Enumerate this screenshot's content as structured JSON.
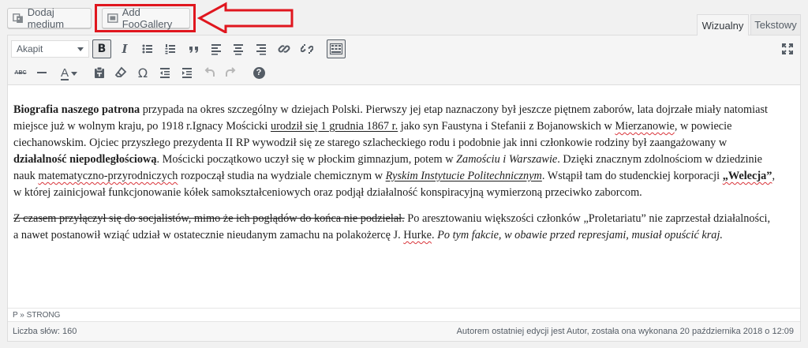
{
  "toolbar_top": {
    "add_media_label": "Dodaj medium",
    "add_foogallery_label": "Add FooGallery",
    "tab_visual": "Wizualny",
    "tab_text": "Tekstowy"
  },
  "editor_toolbar": {
    "format_select_value": "Akapit",
    "row1_icons": [
      "bold-icon",
      "italic-icon",
      "bulleted-list-icon",
      "numbered-list-icon",
      "blockquote-icon",
      "align-left-icon",
      "align-center-icon",
      "align-right-icon",
      "link-icon",
      "unlink-icon",
      "toolbar-toggle-icon",
      "fullscreen-icon"
    ],
    "row2_icons": [
      "strikethrough-icon",
      "horizontal-line-icon",
      "text-color-icon",
      "paste-as-text-icon",
      "clear-formatting-icon",
      "special-character-icon",
      "outdent-icon",
      "indent-icon",
      "undo-icon",
      "redo-icon",
      "help-icon"
    ],
    "bold_glyph": "B",
    "italic_glyph": "I",
    "strike_glyph": "ABC",
    "color_glyph": "A",
    "omega_glyph": "Ω",
    "help_glyph": "?"
  },
  "content": {
    "p1": [
      {
        "t": "Biografia naszego patrona",
        "s": "b"
      },
      {
        "t": " przypada na okres szczególny w dziejach Polski. Pierwszy jej etap naznaczony był jeszcze piętnem zaborów, lata dojrzałe miały natomiast miejsce już w wolnym kraju, po 1918 r.Ignacy Mościcki ",
        "s": ""
      },
      {
        "t": "urodził się 1 grudnia 1867 r.",
        "s": "u"
      },
      {
        "t": " jako syn Faustyna i Stefanii z Bojanowskich w ",
        "s": ""
      },
      {
        "t": "Mierzanowie",
        "s": "sp"
      },
      {
        "t": ", w powiecie ciechanowskim. Ojciec przyszłego prezydenta II RP wywodził się ze starego szlacheckiego rodu i podobnie jak inni członkowie rodziny był zaangażowany w ",
        "s": ""
      },
      {
        "t": "działalność niepodległościową",
        "s": "b"
      },
      {
        "t": ". Mościcki początkowo uczył się w płockim gimnazjum, potem w ",
        "s": ""
      },
      {
        "t": "Zamościu i Warszawie",
        "s": "i"
      },
      {
        "t": ". Dzięki znacznym zdolnościom w dziedzinie nauk ",
        "s": ""
      },
      {
        "t": "matematyczno-przyrodniczych",
        "s": "sp"
      },
      {
        "t": " rozpoczął studia na wydziale chemicznym w ",
        "s": ""
      },
      {
        "t": "Ryskim Instytucie Politechnicznym",
        "s": "iu"
      },
      {
        "t": ". Wstąpił tam do studenckiej korporacji ",
        "s": ""
      },
      {
        "t": "„Welecja”",
        "s": "bsp"
      },
      {
        "t": ", w której zainicjował funkcjonowanie kółek samokształceniowych oraz podjął działalność konspiracyjną wymierzoną przeciwko zaborcom.",
        "s": ""
      }
    ],
    "p2": [
      {
        "t": "Z czasem przyłączył się do socjalistów, mimo że ich poglądów do końca nie podzielał.",
        "s": "s"
      },
      {
        "t": " Po aresztowaniu większości członków „Proletariatu” nie zaprzestał działalności, a nawet postanowił wziąć udział w ostatecznie nieudanym zamachu na polakożercę J. ",
        "s": ""
      },
      {
        "t": "Hurke",
        "s": "sp"
      },
      {
        "t": ". ",
        "s": ""
      },
      {
        "t": "Po tym fakcie, w obawie przed represjami, musiał opuścić kraj.",
        "s": "i"
      }
    ]
  },
  "status": {
    "path": "P » STRONG",
    "word_count": "Liczba słów: 160",
    "last_edit": "Autorem ostatniej edycji jest Autor, została ona wykonana 20 października 2018 o 12:09"
  },
  "colors": {
    "highlight": "#e0161e",
    "toolbar_bg": "#f5f5f5",
    "icon": "#555d66"
  }
}
